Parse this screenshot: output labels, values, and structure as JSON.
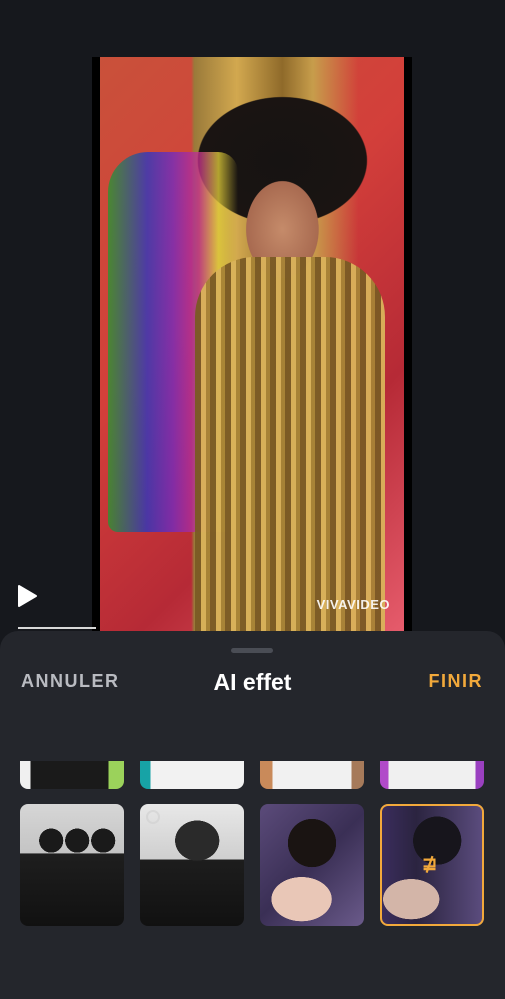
{
  "preview": {
    "watermark": "VIVAVIDEO",
    "playback": {
      "progress_fraction": 0.15
    }
  },
  "panel": {
    "cancel_label": "ANNULER",
    "title": "AI effet",
    "finish_label": "FINIR",
    "colors": {
      "accent": "#f2a93b",
      "panel_bg": "#24262c",
      "page_bg": "#15171c"
    }
  },
  "effects_row_top": [
    {
      "icon": "effect-thumbnail"
    },
    {
      "icon": "effect-thumbnail"
    },
    {
      "icon": "effect-thumbnail"
    },
    {
      "icon": "effect-thumbnail"
    }
  ],
  "effects_row_bottom": [
    {
      "icon": "bw-echo-effect",
      "selected": false
    },
    {
      "icon": "bw-blur-effect",
      "selected": false
    },
    {
      "icon": "color-glitch-effect",
      "selected": false
    },
    {
      "icon": "color-glitch-2-effect",
      "selected": true,
      "selected_glyph": "⋣"
    }
  ]
}
